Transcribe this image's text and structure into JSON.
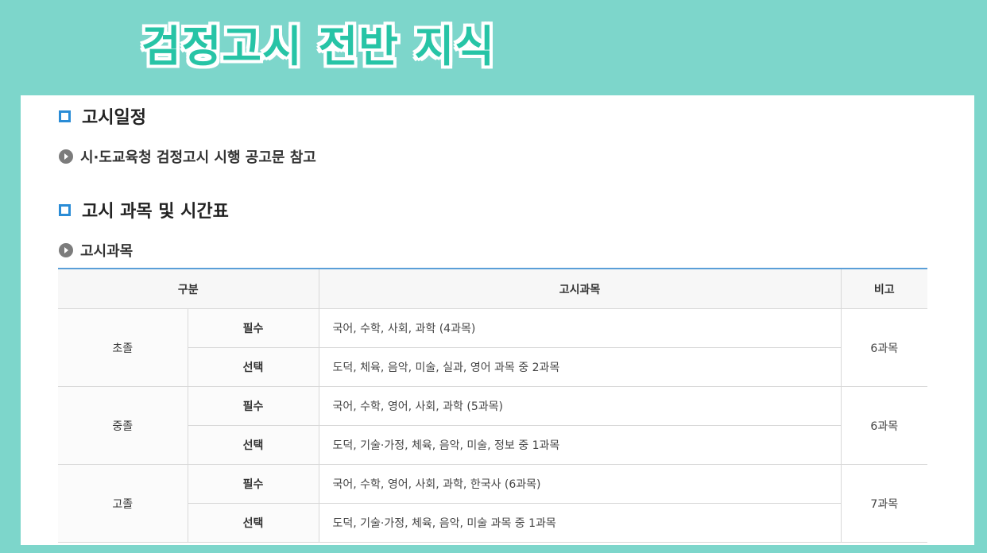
{
  "banner": {
    "title": "검정고시 전반 지식"
  },
  "sections": {
    "schedule": {
      "heading": "고시일정",
      "note": "시·도교육청 검정고시 시행 공고문 참고"
    },
    "subjects": {
      "heading": "고시 과목 및 시간표",
      "subheading": "고시과목"
    }
  },
  "table": {
    "headers": {
      "category": "구분",
      "subjects": "고시과목",
      "note": "비고"
    },
    "groups": [
      {
        "name": "초졸",
        "note": "6과목",
        "rows": [
          {
            "kind": "필수",
            "subjects": "국어, 수학, 사회, 과학 (4과목)"
          },
          {
            "kind": "선택",
            "subjects": "도덕, 체육, 음악, 미술, 실과, 영어 과목 중 2과목"
          }
        ]
      },
      {
        "name": "중졸",
        "note": "6과목",
        "rows": [
          {
            "kind": "필수",
            "subjects": "국어, 수학, 영어, 사회, 과학 (5과목)"
          },
          {
            "kind": "선택",
            "subjects": "도덕, 기술·가정, 체육, 음악, 미술, 정보 중 1과목"
          }
        ]
      },
      {
        "name": "고졸",
        "note": "7과목",
        "rows": [
          {
            "kind": "필수",
            "subjects": "국어, 수학, 영어, 사회, 과학, 한국사 (6과목)"
          },
          {
            "kind": "선택",
            "subjects": "도덕, 기술·가정, 체육, 음악, 미술 과목 중 1과목"
          }
        ]
      }
    ]
  }
}
